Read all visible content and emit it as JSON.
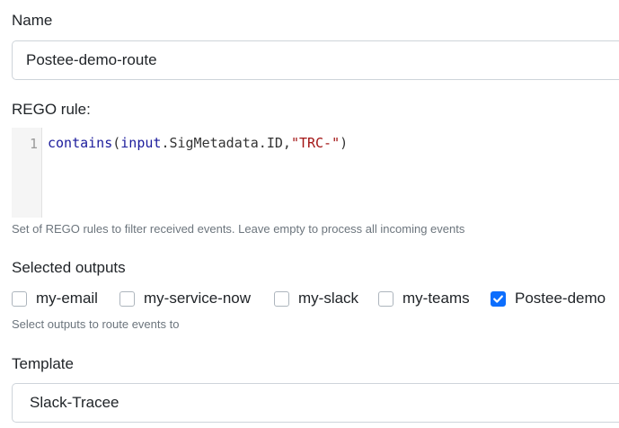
{
  "name": {
    "label": "Name",
    "value": "Postee-demo-route"
  },
  "rego": {
    "label": "REGO rule:",
    "line_number": "1",
    "code": {
      "fn": "contains",
      "open": "(",
      "var": "input",
      "path": ".SigMetadata.ID,",
      "str": "\"TRC-\"",
      "close": ")"
    },
    "help": "Set of REGO rules to filter received events. Leave empty to process all incoming events"
  },
  "outputs": {
    "label": "Selected outputs",
    "items": [
      {
        "label": "my-email",
        "checked": false
      },
      {
        "label": "my-service-now",
        "checked": false
      },
      {
        "label": "my-slack",
        "checked": false
      },
      {
        "label": "my-teams",
        "checked": false
      },
      {
        "label": "Postee-demo",
        "checked": true
      }
    ],
    "help": "Select outputs to route events to"
  },
  "template": {
    "label": "Template",
    "value": "Slack-Tracee"
  },
  "colors": {
    "accent": "#0d6efd",
    "border": "#ced4da",
    "muted_text": "#6c757d",
    "string": "#a31515",
    "keyword": "#1c1c9c"
  }
}
